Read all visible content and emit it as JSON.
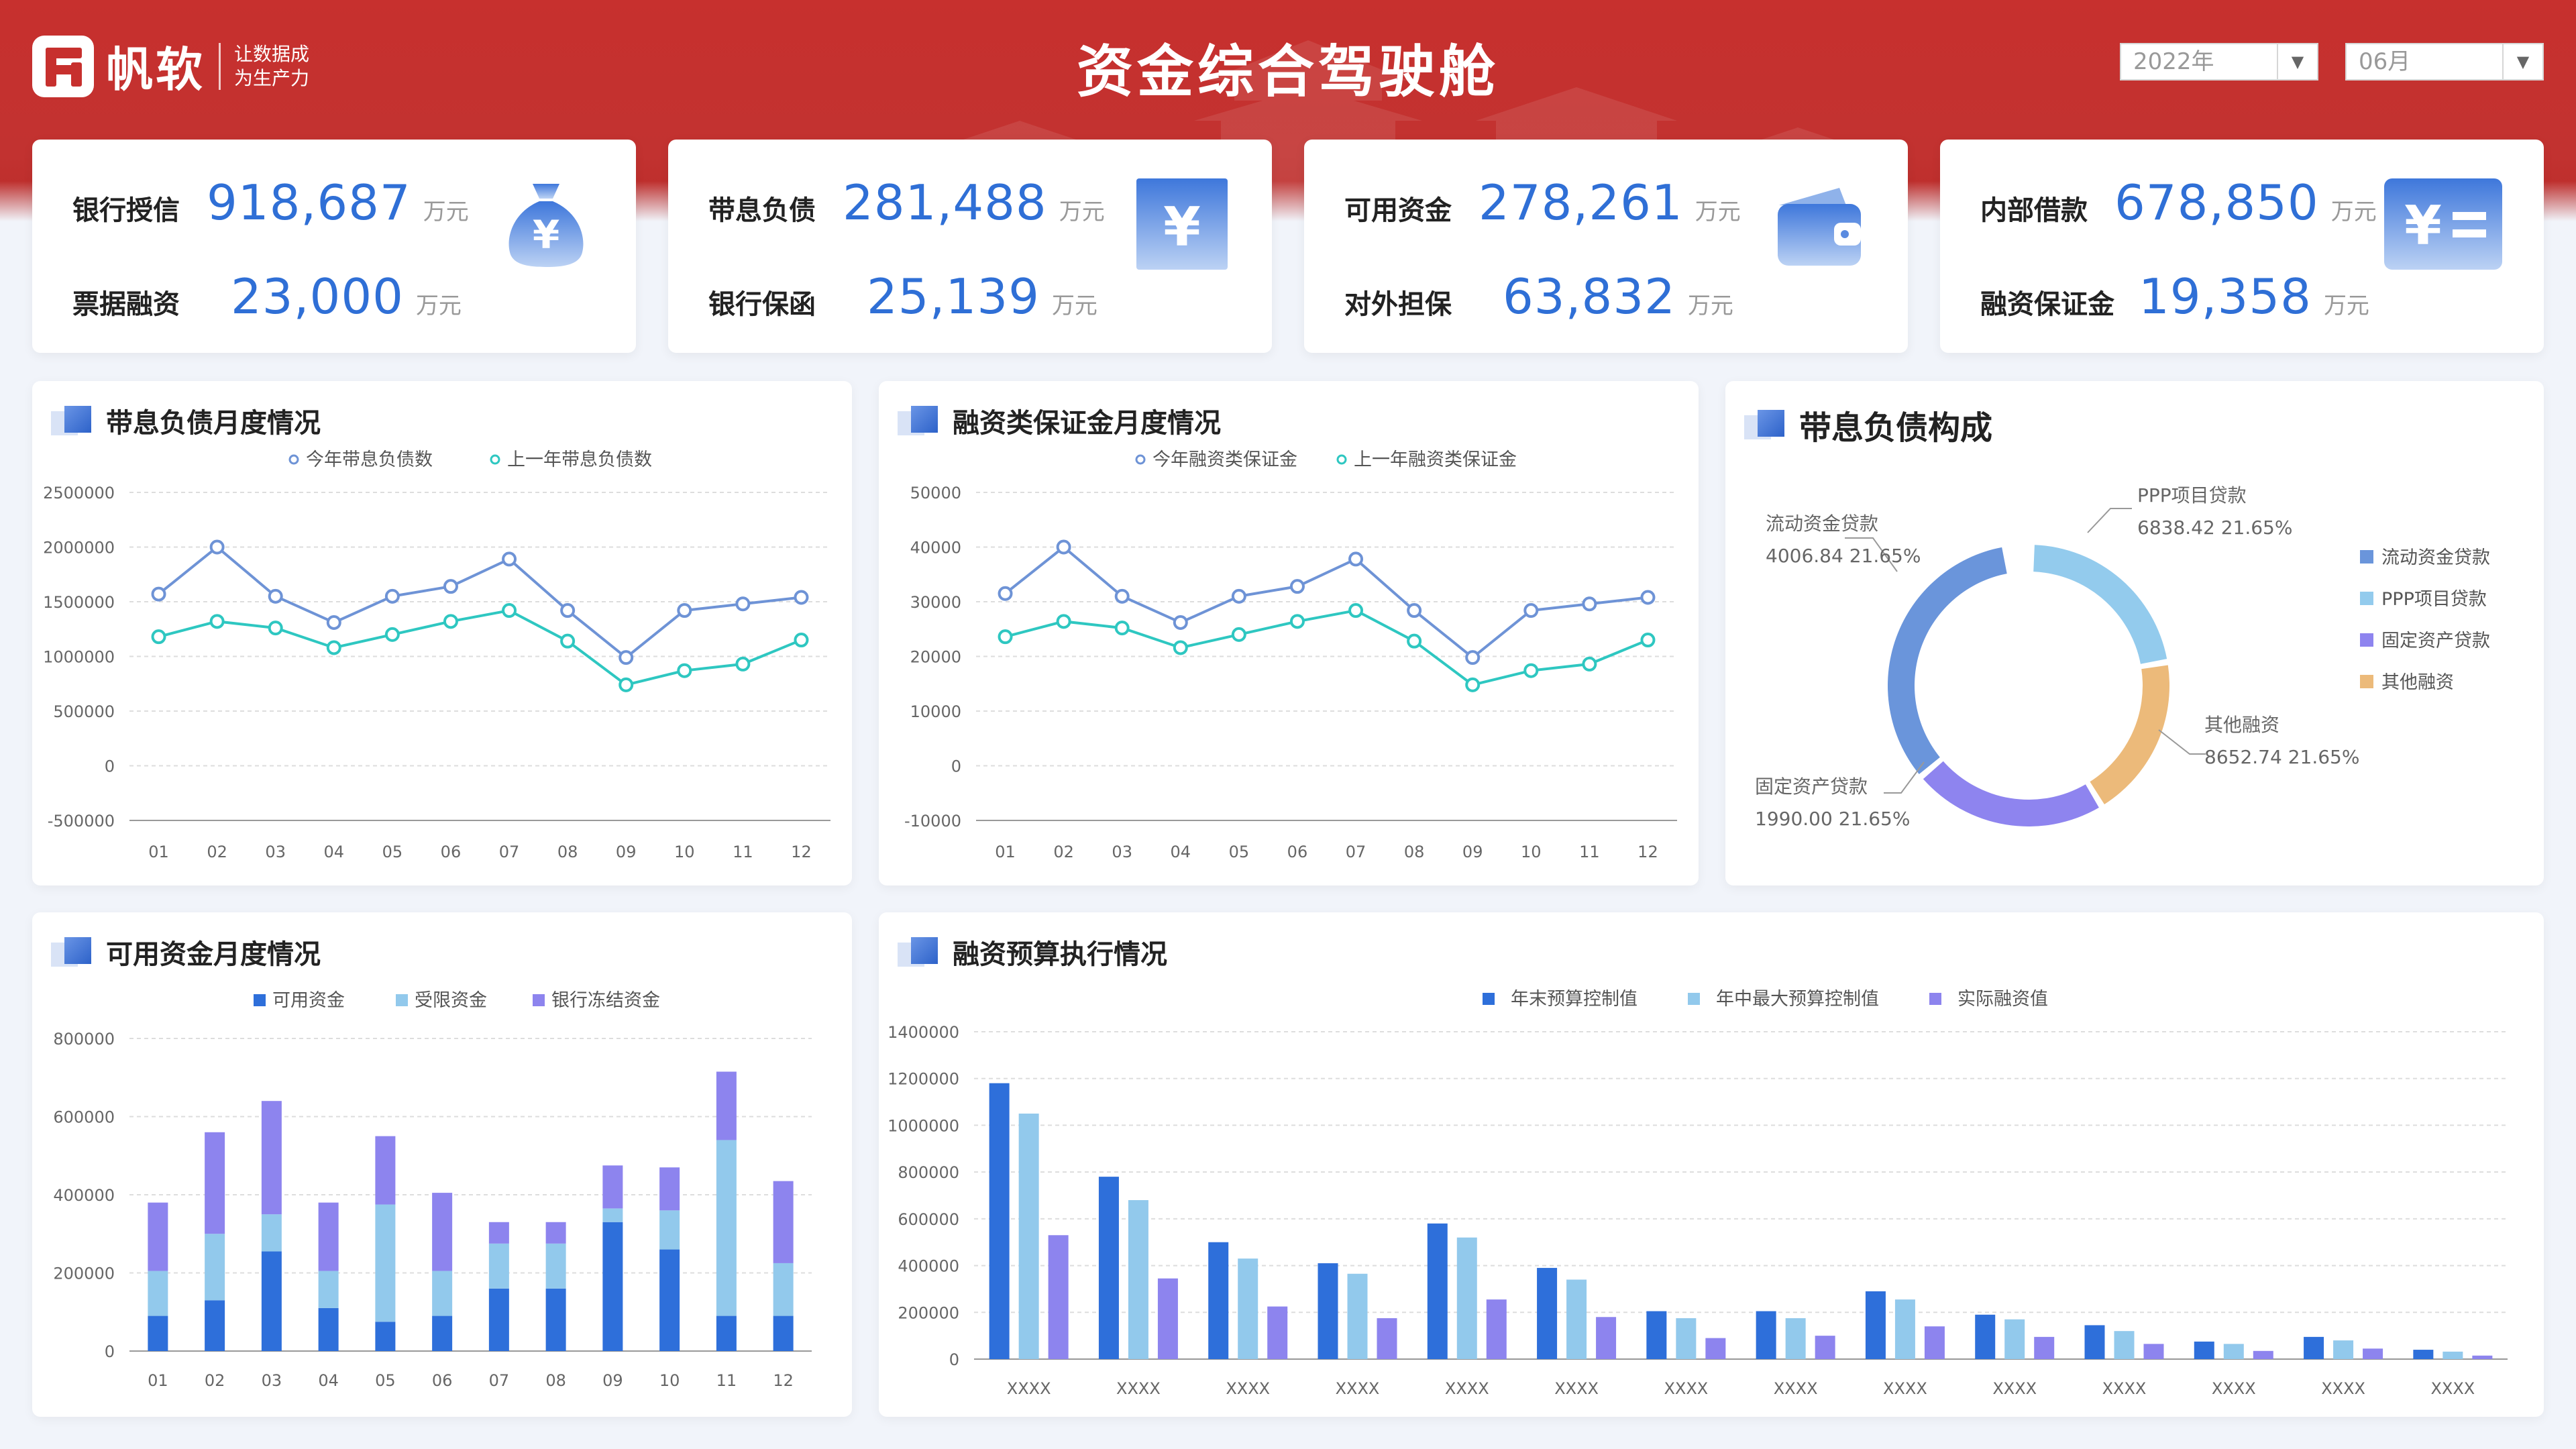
{
  "header": {
    "brand_name": "帆软",
    "slogan_line1": "让数据成",
    "slogan_line2": "为生产力",
    "title": "资金综合驾驶舱",
    "year_select": "2022年",
    "month_select": "06月"
  },
  "kpis": [
    {
      "label1": "银行授信",
      "value1": "918,687",
      "unit1": "万元",
      "label2": "票据融资",
      "value2": "23,000",
      "unit2": "万元",
      "icon": "money-bag-icon"
    },
    {
      "label1": "带息负债",
      "value1": "281,488",
      "unit1": "万元",
      "label2": "银行保函",
      "value2": "25,139",
      "unit2": "万元",
      "icon": "yuan-card-icon"
    },
    {
      "label1": "可用资金",
      "value1": "278,261",
      "unit1": "万元",
      "label2": "对外担保",
      "value2": "63,832",
      "unit2": "万元",
      "icon": "wallet-icon"
    },
    {
      "label1": "内部借款",
      "value1": "678,850",
      "unit1": "万元",
      "label2": "融资保证金",
      "value2": "19,358",
      "unit2": "万元",
      "icon": "yuan-equal-icon"
    }
  ],
  "colors": {
    "blue": "#6e93d6",
    "teal": "#2ec7c1",
    "bar_dark": "#2e6fda",
    "bar_light": "#92c9ec",
    "bar_purple": "#8d84ee",
    "donut_blue": "#6a95db",
    "donut_light": "#93cbed",
    "donut_purple": "#8e84ef",
    "donut_orange": "#ecba7a"
  },
  "panels": {
    "p1_title": "带息负债月度情况",
    "p2_title": "融资类保证金月度情况",
    "p3_title": "带息负债构成",
    "p4_title": "可用资金月度情况",
    "p5_title": "融资预算执行情况"
  },
  "chart_data": [
    {
      "type": "line",
      "categories": [
        "01",
        "02",
        "03",
        "04",
        "05",
        "06",
        "07",
        "08",
        "09",
        "10",
        "11",
        "12"
      ],
      "series": [
        {
          "name": "今年带息负债数",
          "values": [
            1570000,
            2000000,
            1550000,
            1310000,
            1550000,
            1640000,
            1890000,
            1420000,
            990000,
            1420000,
            1480000,
            1540000
          ]
        },
        {
          "name": "上一年带息负债数",
          "values": [
            1180000,
            1320000,
            1260000,
            1080000,
            1200000,
            1320000,
            1420000,
            1140000,
            740000,
            870000,
            930000,
            1150000
          ]
        }
      ],
      "ylim": [
        -500000,
        2500000
      ],
      "yticks": [
        "2500000",
        "2000000",
        "1500000",
        "1000000",
        "500000",
        "0",
        "-500000"
      ],
      "legend": "top-center"
    },
    {
      "type": "line",
      "categories": [
        "01",
        "02",
        "03",
        "04",
        "05",
        "06",
        "07",
        "08",
        "09",
        "10",
        "11",
        "12"
      ],
      "series": [
        {
          "name": "今年融资类保证金",
          "values": [
            31500,
            40000,
            31000,
            26200,
            31000,
            32800,
            37800,
            28400,
            19800,
            28400,
            29600,
            30800
          ]
        },
        {
          "name": "上一年融资类保证金",
          "values": [
            23600,
            26400,
            25200,
            21600,
            24000,
            26400,
            28400,
            22800,
            14800,
            17400,
            18600,
            23000
          ]
        }
      ],
      "ylim": [
        -10000,
        50000
      ],
      "yticks": [
        "50000",
        "40000",
        "30000",
        "20000",
        "10000",
        "0",
        "-10000"
      ],
      "legend": "top-center"
    },
    {
      "type": "pie",
      "slices": [
        {
          "name": "流动资金贷款",
          "value": "4006.84",
          "pct": "21.65%"
        },
        {
          "name": "PPP项目贷款",
          "value": "6838.42",
          "pct": "21.65%"
        },
        {
          "name": "其他融资",
          "value": "8652.74",
          "pct": "21.65%"
        },
        {
          "name": "固定资产贷款",
          "value": "1990.00",
          "pct": "21.65%"
        }
      ],
      "arc_fractions": [
        0.335,
        0.22,
        0.19,
        0.225
      ],
      "legend": [
        "流动资金贷款",
        "PPP项目贷款",
        "固定资产贷款",
        "其他融资"
      ]
    },
    {
      "type": "bar",
      "stacked": true,
      "categories": [
        "01",
        "02",
        "03",
        "04",
        "05",
        "06",
        "07",
        "08",
        "09",
        "10",
        "11",
        "12"
      ],
      "series": [
        {
          "name": "可用资金",
          "values": [
            90000,
            130000,
            255000,
            110000,
            75000,
            90000,
            160000,
            160000,
            330000,
            260000,
            90000,
            90000
          ]
        },
        {
          "name": "受限资金",
          "values": [
            115000,
            170000,
            95000,
            95000,
            300000,
            115000,
            115000,
            115000,
            35000,
            100000,
            450000,
            135000
          ]
        },
        {
          "name": "银行冻结资金",
          "values": [
            175000,
            260000,
            290000,
            175000,
            175000,
            200000,
            55000,
            55000,
            110000,
            110000,
            175000,
            210000
          ]
        }
      ],
      "ylim": [
        0,
        800000
      ],
      "yticks": [
        "800000",
        "600000",
        "400000",
        "200000",
        "0"
      ],
      "legend": "top-center"
    },
    {
      "type": "bar",
      "categories": [
        "XXXX",
        "XXXX",
        "XXXX",
        "XXXX",
        "XXXX",
        "XXXX",
        "XXXX",
        "XXXX",
        "XXXX",
        "XXXX",
        "XXXX",
        "XXXX",
        "XXXX",
        "XXXX"
      ],
      "series": [
        {
          "name": "年末预算控制值",
          "values": [
            1180000,
            780000,
            500000,
            410000,
            580000,
            390000,
            205000,
            205000,
            290000,
            190000,
            145000,
            75000,
            95000,
            40000
          ]
        },
        {
          "name": "年中最大预算控制值",
          "values": [
            1050000,
            680000,
            430000,
            365000,
            520000,
            340000,
            175000,
            175000,
            255000,
            170000,
            120000,
            65000,
            80000,
            32000
          ]
        },
        {
          "name": "实际融资值",
          "values": [
            530000,
            345000,
            225000,
            175000,
            255000,
            180000,
            90000,
            100000,
            140000,
            95000,
            65000,
            35000,
            45000,
            15000
          ]
        }
      ],
      "ylim": [
        0,
        1400000
      ],
      "yticks": [
        "1400000",
        "1200000",
        "1000000",
        "800000",
        "600000",
        "400000",
        "200000",
        "0"
      ],
      "legend": "top-center"
    }
  ]
}
